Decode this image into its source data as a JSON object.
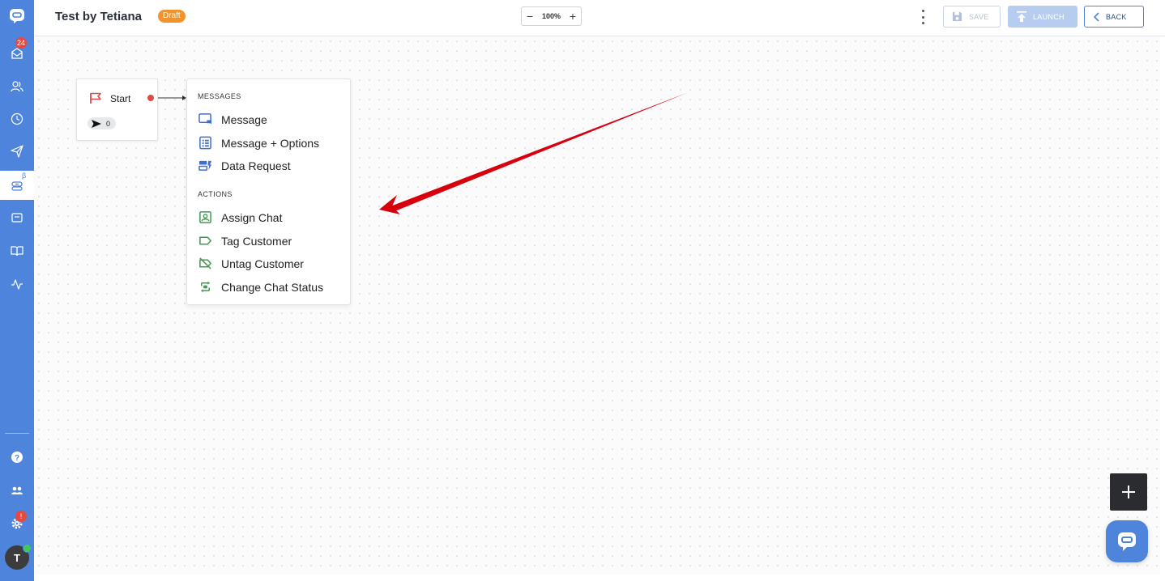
{
  "header": {
    "title": "Test by Tetiana",
    "status_badge": "Draft",
    "zoom_level": "100%",
    "save_label": "SAVE",
    "launch_label": "LAUNCH",
    "back_label": "BACK"
  },
  "sidebar": {
    "inbox_badge": "24",
    "beta_mark": "β",
    "settings_badge": "!",
    "avatar_initial": "T",
    "items": [
      {
        "icon": "chat-logo-icon"
      },
      {
        "icon": "inbox-icon"
      },
      {
        "icon": "contacts-icon"
      },
      {
        "icon": "history-icon"
      },
      {
        "icon": "send-icon"
      },
      {
        "icon": "bot-icon"
      },
      {
        "icon": "widget-icon"
      },
      {
        "icon": "book-icon"
      },
      {
        "icon": "analytics-icon"
      },
      {
        "icon": "help-icon"
      },
      {
        "icon": "team-icon"
      },
      {
        "icon": "settings-icon"
      }
    ]
  },
  "flow": {
    "start_node": {
      "label": "Start",
      "count": "0"
    },
    "menu": {
      "messages_heading": "MESSAGES",
      "messages": [
        {
          "label": "Message",
          "icon": "message-icon"
        },
        {
          "label": "Message + Options",
          "icon": "message-options-icon"
        },
        {
          "label": "Data Request",
          "icon": "data-request-icon"
        }
      ],
      "actions_heading": "ACTIONS",
      "actions": [
        {
          "label": "Assign Chat",
          "icon": "assign-chat-icon"
        },
        {
          "label": "Tag Customer",
          "icon": "tag-icon"
        },
        {
          "label": "Untag Customer",
          "icon": "untag-icon"
        },
        {
          "label": "Change Chat Status",
          "icon": "change-status-icon"
        }
      ]
    }
  },
  "colors": {
    "accent": "#4f84dc",
    "draft": "#f1922b",
    "action_green": "#3f9a52",
    "annotation_red": "#d8000c"
  }
}
